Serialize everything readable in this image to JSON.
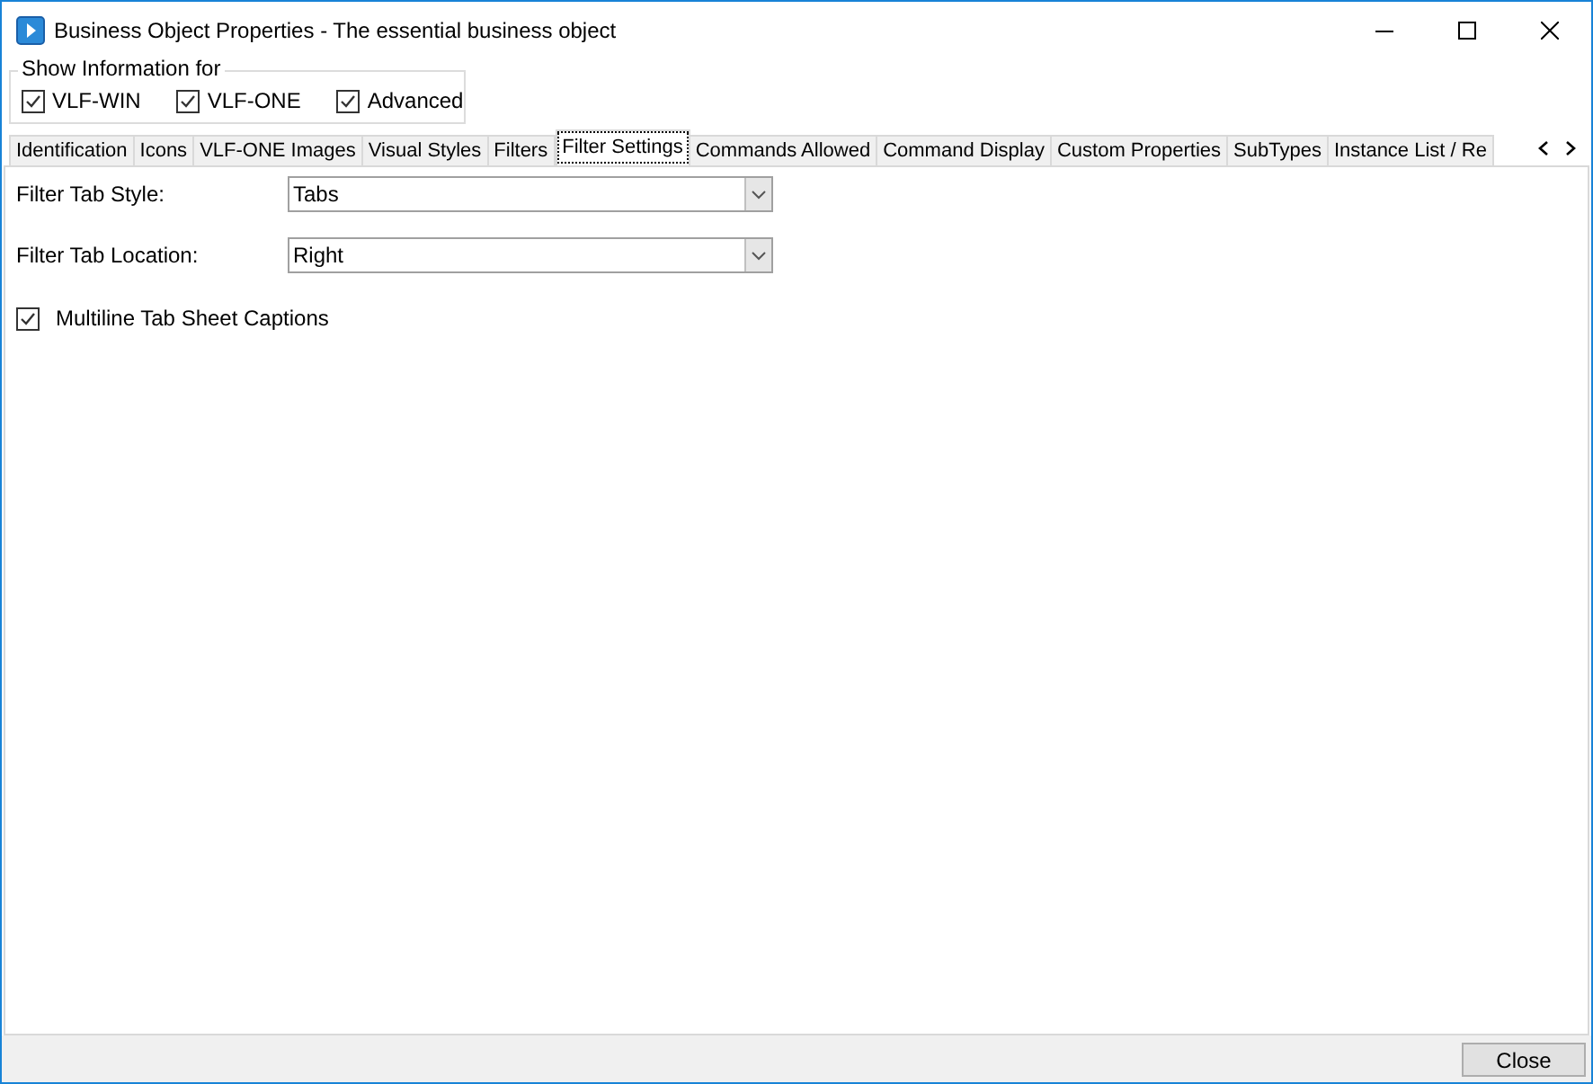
{
  "window": {
    "title": "Business Object Properties - The essential business object"
  },
  "show_information": {
    "legend": "Show Information for",
    "options": [
      {
        "label": "VLF-WIN",
        "checked": true
      },
      {
        "label": "VLF-ONE",
        "checked": true
      },
      {
        "label": "Advanced",
        "checked": true
      }
    ]
  },
  "tabs": [
    {
      "label": "Identification",
      "selected": false
    },
    {
      "label": "Icons",
      "selected": false
    },
    {
      "label": "VLF-ONE Images",
      "selected": false
    },
    {
      "label": "Visual Styles",
      "selected": false
    },
    {
      "label": "Filters",
      "selected": false
    },
    {
      "label": "Filter Settings",
      "selected": true
    },
    {
      "label": "Commands Allowed",
      "selected": false
    },
    {
      "label": "Command Display",
      "selected": false
    },
    {
      "label": "Custom Properties",
      "selected": false
    },
    {
      "label": "SubTypes",
      "selected": false
    },
    {
      "label": "Instance List / Re",
      "selected": false
    }
  ],
  "fields": [
    {
      "label": "Filter Tab Style:",
      "value": "Tabs"
    },
    {
      "label": "Filter Tab Location:",
      "value": "Right"
    }
  ],
  "multiline_captions": {
    "label": "Multiline Tab Sheet Captions",
    "checked": true
  },
  "buttons": [
    "Close"
  ]
}
